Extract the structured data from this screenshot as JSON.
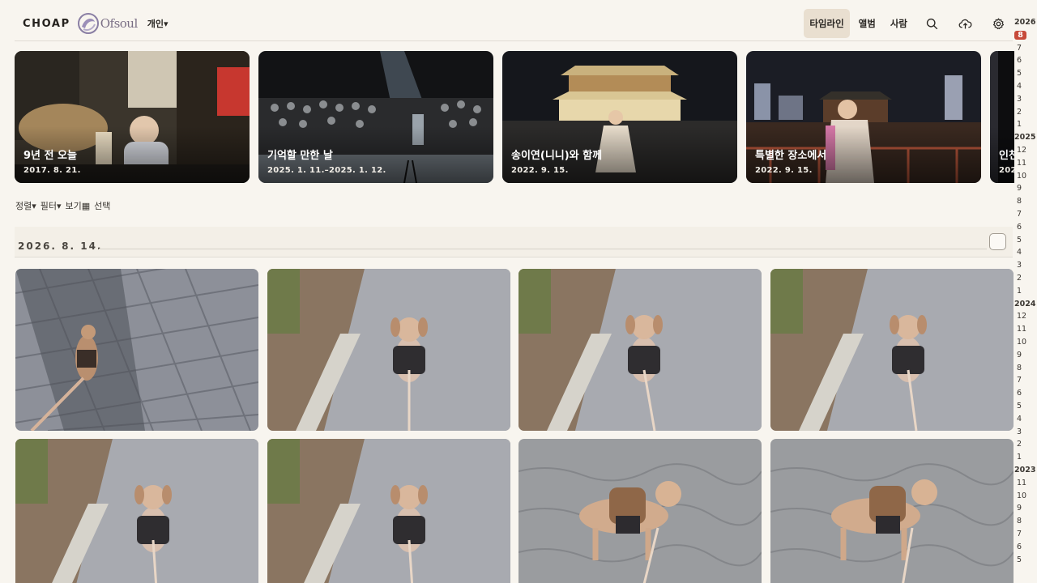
{
  "header": {
    "brand": "CHOAP",
    "logo_mark": "Ofsoul",
    "scope_label": "개인▾",
    "tabs": [
      {
        "label": "타임라인",
        "active": true
      },
      {
        "label": "앨범",
        "active": false
      },
      {
        "label": "사람",
        "active": false
      }
    ],
    "icons": [
      "search-icon",
      "upload-cloud-icon",
      "gear-icon"
    ]
  },
  "memories": [
    {
      "title": "9년 전 오늘",
      "date": "2017. 8. 21."
    },
    {
      "title": "기억할 만한 날",
      "date": "2025. 1. 11.–2025. 1. 12."
    },
    {
      "title": "송이연(니니)와 함께",
      "date": "2022. 9. 15."
    },
    {
      "title": "특별한 장소에서",
      "date": "2022. 9. 15."
    },
    {
      "title": "인천",
      "date": "202"
    }
  ],
  "toolbar": {
    "sort": "정렬▾",
    "filter": "필터▾",
    "view": "보기▦",
    "select": "선택"
  },
  "group": {
    "date": "2026. 8. 14."
  },
  "photos": [
    {
      "subject": "dog walking on paving stones in shadow"
    },
    {
      "subject": "small dog facing camera on path"
    },
    {
      "subject": "small dog facing camera on path"
    },
    {
      "subject": "small dog facing camera on path"
    },
    {
      "subject": "small dog facing camera on path"
    },
    {
      "subject": "small dog facing camera on path"
    },
    {
      "subject": "dog with backpack standing sideways"
    },
    {
      "subject": "dog with backpack standing sideways"
    }
  ],
  "scrubber": {
    "entries": [
      {
        "label": "2026",
        "type": "year"
      },
      {
        "label": "8",
        "type": "current"
      },
      {
        "label": "7"
      },
      {
        "label": "6"
      },
      {
        "label": "5"
      },
      {
        "label": "4"
      },
      {
        "label": "3"
      },
      {
        "label": "2"
      },
      {
        "label": "1"
      },
      {
        "label": "2025",
        "type": "year"
      },
      {
        "label": "12"
      },
      {
        "label": "11"
      },
      {
        "label": "10"
      },
      {
        "label": "9"
      },
      {
        "label": "8"
      },
      {
        "label": "7"
      },
      {
        "label": "6"
      },
      {
        "label": "5"
      },
      {
        "label": "4"
      },
      {
        "label": "3"
      },
      {
        "label": "2"
      },
      {
        "label": "1"
      },
      {
        "label": "2024",
        "type": "year"
      },
      {
        "label": "12"
      },
      {
        "label": "11"
      },
      {
        "label": "10"
      },
      {
        "label": "9"
      },
      {
        "label": "8"
      },
      {
        "label": "7"
      },
      {
        "label": "6"
      },
      {
        "label": "5"
      },
      {
        "label": "4"
      },
      {
        "label": "3"
      },
      {
        "label": "2"
      },
      {
        "label": "1"
      },
      {
        "label": "2023",
        "type": "year"
      },
      {
        "label": "11"
      },
      {
        "label": "10"
      },
      {
        "label": "9"
      },
      {
        "label": "8"
      },
      {
        "label": "7"
      },
      {
        "label": "6"
      },
      {
        "label": "5"
      }
    ]
  },
  "colors": {
    "background": "#f8f5ef",
    "active_tab": "#e9dfd0",
    "scrubber_current": "#c74a3a"
  }
}
